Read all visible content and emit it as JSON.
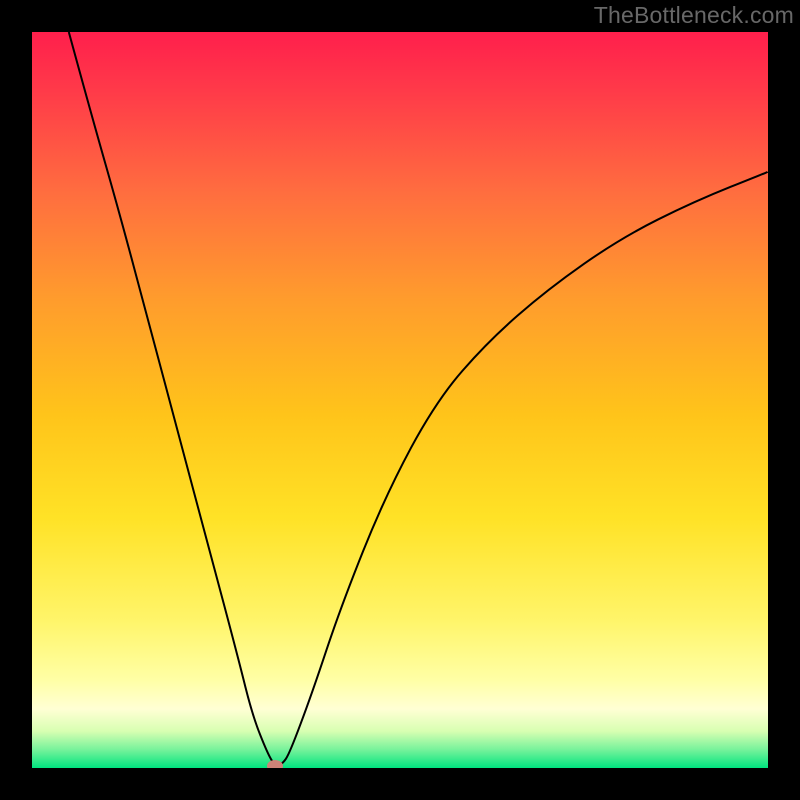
{
  "watermark": "TheBottleneck.com",
  "chart_data": {
    "type": "line",
    "title": "",
    "xlabel": "",
    "ylabel": "",
    "x_range": [
      0,
      100
    ],
    "y_range": [
      0,
      100
    ],
    "grid": false,
    "legend": false,
    "background_gradient": {
      "top": "#ff1f4c",
      "mid": "#ffe226",
      "bottom": "#00e47f"
    },
    "series": [
      {
        "name": "bottleneck-curve",
        "color": "#000000",
        "stroke_width": 2,
        "x": [
          5,
          8,
          12,
          16,
          20,
          24,
          28,
          30,
          32,
          33,
          34,
          35,
          38,
          42,
          48,
          55,
          62,
          70,
          80,
          90,
          100
        ],
        "y": [
          100,
          89,
          75,
          60,
          45,
          30,
          15,
          7,
          2,
          0.3,
          0.5,
          2,
          10,
          22,
          37,
          50,
          58,
          65,
          72,
          77,
          81
        ]
      }
    ],
    "marker": {
      "name": "optimal-point",
      "color": "#cd8378",
      "x": 33,
      "y": 0.3
    }
  }
}
